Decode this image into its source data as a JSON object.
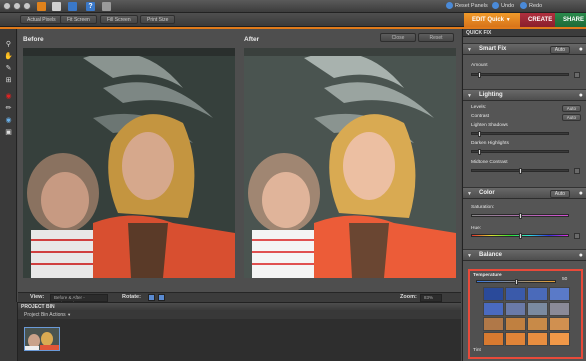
{
  "topbar": {
    "reset_panels": "Reset Panels",
    "undo": "Undo",
    "redo": "Redo"
  },
  "view_buttons": [
    "Actual Pixels",
    "Fit Screen",
    "Fill Screen",
    "Print Size"
  ],
  "modes": {
    "edit": "EDIT Quick",
    "create": "CREATE",
    "share": "SHARE"
  },
  "canvas": {
    "before_label": "Before",
    "after_label": "After",
    "close_label": "Close",
    "reset_label": "Reset"
  },
  "viewbar": {
    "view_label": "View:",
    "view_value": "Before & After - Horizontal",
    "rotate_label": "Rotate:",
    "zoom_label": "Zoom:",
    "zoom_value": "83%"
  },
  "bin": {
    "title": "PROJECT BIN",
    "actions": "Project Bin Actions"
  },
  "panel": {
    "title": "QUICK FIX",
    "smart_fix": {
      "name": "Smart Fix",
      "auto": "Auto",
      "amount": "Amount"
    },
    "lighting": {
      "name": "Lighting",
      "levels": "Levels:",
      "contrast": "Contrast",
      "lighten_shadows": "Lighten Shadows",
      "darken_highlights": "Darken Highlights",
      "midtone_contrast": "Midtone Contrast",
      "auto": "Auto"
    },
    "color": {
      "name": "Color",
      "auto": "Auto",
      "saturation": "Saturation:",
      "hue": "Hue:"
    },
    "balance": {
      "name": "Balance",
      "temperature": "Temperature",
      "tint": "Tint",
      "value": "50"
    }
  },
  "colors": {
    "edit_mode": "#e07a1a",
    "create_mode": "#a02a38",
    "share_mode": "#278048",
    "highlight_box": "#e84a3a"
  }
}
